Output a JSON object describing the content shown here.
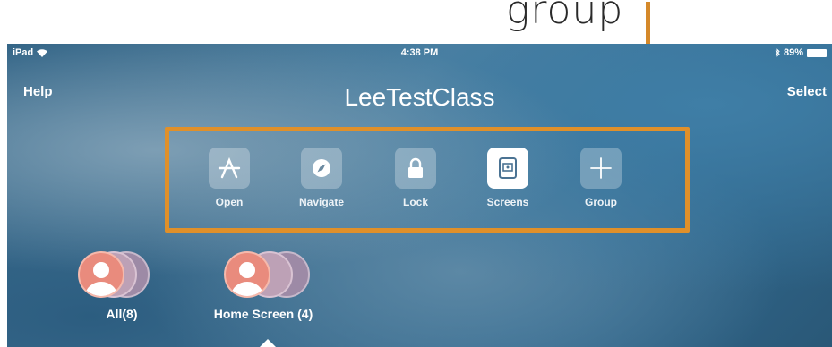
{
  "annotation": {
    "text": "group",
    "arrow_color": "#d5892a"
  },
  "status_bar": {
    "carrier": "iPad",
    "time": "4:38 PM",
    "battery": "89%"
  },
  "nav": {
    "left": "Help",
    "title": "LeeTestClass",
    "right": "Select"
  },
  "toolbar": {
    "highlight_color": "#e0902a",
    "items": [
      {
        "label": "Open",
        "icon": "app-store-icon",
        "active": false
      },
      {
        "label": "Navigate",
        "icon": "compass-icon",
        "active": false
      },
      {
        "label": "Lock",
        "icon": "lock-icon",
        "active": false
      },
      {
        "label": "Screens",
        "icon": "screens-icon",
        "active": true
      },
      {
        "label": "Group",
        "icon": "plus-icon",
        "active": false
      }
    ]
  },
  "groups": [
    {
      "label": "All(8)"
    },
    {
      "label": "Home Screen (4)",
      "selected": true
    }
  ]
}
